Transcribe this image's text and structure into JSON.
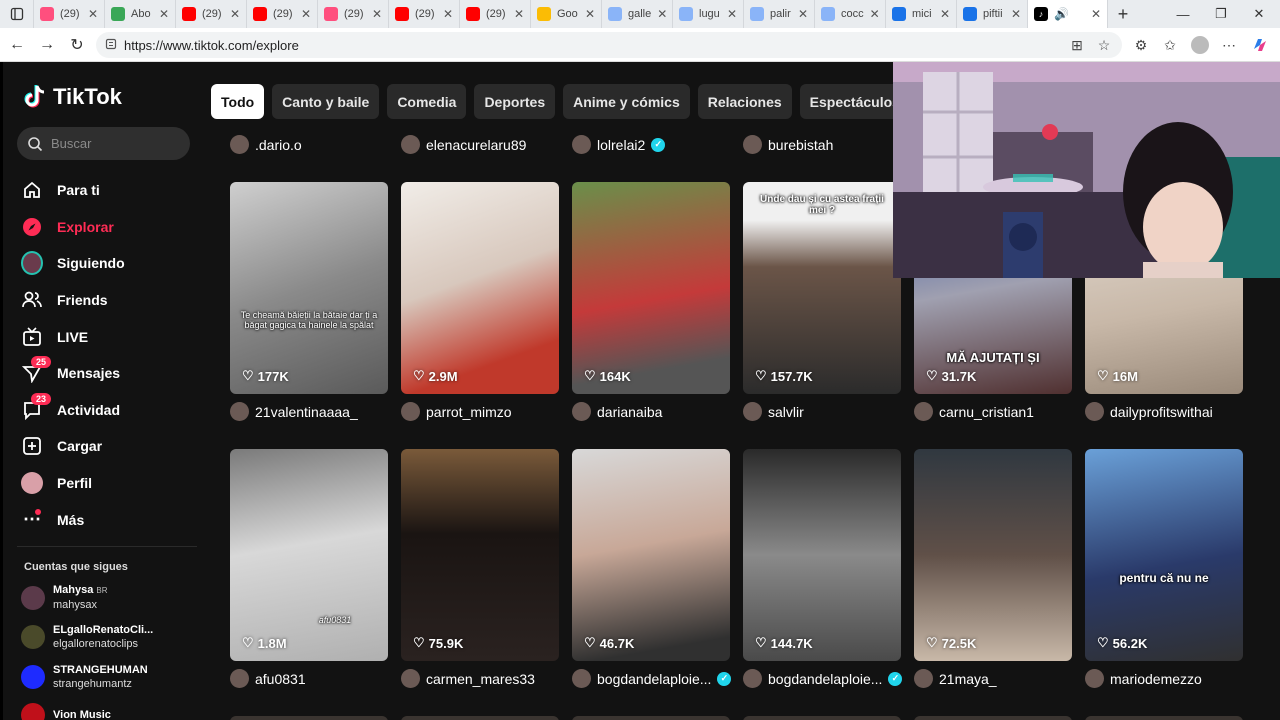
{
  "browser": {
    "tabs": [
      {
        "label": "(29)",
        "color": "#ff4f7e"
      },
      {
        "label": "Abo",
        "color": "#3aa757"
      },
      {
        "label": "(29)",
        "color": "#ff0000"
      },
      {
        "label": "(29)",
        "color": "#ff0000"
      },
      {
        "label": "(29)",
        "color": "#ff4f7e"
      },
      {
        "label": "(29)",
        "color": "#ff0000"
      },
      {
        "label": "(29)",
        "color": "#ff0000"
      },
      {
        "label": "Goo",
        "color": "#fbbc05"
      },
      {
        "label": "galle",
        "color": "#8ab4f8"
      },
      {
        "label": "lugu",
        "color": "#8ab4f8"
      },
      {
        "label": "palir",
        "color": "#8ab4f8"
      },
      {
        "label": "cocc",
        "color": "#8ab4f8"
      },
      {
        "label": "mici",
        "color": "#1a73e8"
      },
      {
        "label": "piftii",
        "color": "#1a73e8"
      }
    ],
    "url": "https://www.tiktok.com/explore"
  },
  "sidebar": {
    "brand": "TikTok",
    "search_placeholder": "Buscar",
    "nav": [
      {
        "label": "Para ti",
        "icon": "home-icon"
      },
      {
        "label": "Explorar",
        "icon": "compass-icon"
      },
      {
        "label": "Siguiendo",
        "icon": "following-avatar-icon"
      },
      {
        "label": "Friends",
        "icon": "friends-icon"
      },
      {
        "label": "LIVE",
        "icon": "live-tv-icon"
      },
      {
        "label": "Mensajes",
        "icon": "message-icon",
        "badge": "25"
      },
      {
        "label": "Actividad",
        "icon": "activity-icon",
        "badge": "23"
      },
      {
        "label": "Cargar",
        "icon": "upload-icon"
      },
      {
        "label": "Perfil",
        "icon": "profile-avatar-icon"
      },
      {
        "label": "Más",
        "icon": "more-icon"
      }
    ],
    "following_title": "Cuentas que sigues",
    "following": [
      {
        "name": "Mahysa",
        "tag": "BR",
        "handle": "mahysax",
        "color": "#5b3a4a"
      },
      {
        "name": "ELgalloRenatoCli...",
        "tag": "",
        "handle": "elgallorenatoclips",
        "color": "#4a4a2a"
      },
      {
        "name": "STRANGEHUMAN",
        "tag": "",
        "handle": "strangehumantz",
        "color": "#1e2bff"
      },
      {
        "name": "Vion Music",
        "tag": "",
        "handle": "",
        "color": "#c0101a"
      }
    ]
  },
  "main": {
    "chips": [
      "Todo",
      "Canto y baile",
      "Comedia",
      "Deportes",
      "Anime y cómics",
      "Relaciones",
      "Espectáculos"
    ],
    "top_users": [
      {
        "name": ".dario.o",
        "verified": false
      },
      {
        "name": "elenacurelaru89",
        "verified": false
      },
      {
        "name": "lolrelai2",
        "verified": true
      },
      {
        "name": "burebistah",
        "verified": false
      }
    ],
    "row1": [
      {
        "likes": "177K",
        "user": "21valentinaaaa_",
        "verified": false,
        "caption": "Te cheamă băieții la bătaie dar ți a băgat gagica ta hainele la spălat"
      },
      {
        "likes": "2.9M",
        "user": "parrot_mimzo",
        "verified": false,
        "caption": ""
      },
      {
        "likes": "164K",
        "user": "darianaiba",
        "verified": false,
        "caption": ""
      },
      {
        "likes": "157.7K",
        "user": "salvlir",
        "verified": false,
        "caption": "Unde dau și cu astea frații mei ?"
      },
      {
        "likes": "31.7K",
        "user": "carnu_cristian1",
        "verified": false,
        "caption": "MĂ AJUTAȚI ȘI"
      },
      {
        "likes": "16M",
        "user": "dailyprofitswithai",
        "verified": false,
        "caption": ""
      }
    ],
    "row2": [
      {
        "likes": "1.8M",
        "user": "afu0831",
        "verified": false,
        "caption": "afu0831"
      },
      {
        "likes": "75.9K",
        "user": "carmen_mares33",
        "verified": false,
        "caption": ""
      },
      {
        "likes": "46.7K",
        "user": "bogdandelaploie...",
        "verified": true,
        "caption": ""
      },
      {
        "likes": "144.7K",
        "user": "bogdandelaploie...",
        "verified": true,
        "caption": ""
      },
      {
        "likes": "72.5K",
        "user": "21maya_",
        "verified": false,
        "caption": ""
      },
      {
        "likes": "56.2K",
        "user": "mariodemezzo",
        "verified": false,
        "caption": "pentru că nu ne"
      }
    ]
  },
  "colors": {
    "accent": "#fe2c55",
    "verified": "#20d5ec"
  }
}
